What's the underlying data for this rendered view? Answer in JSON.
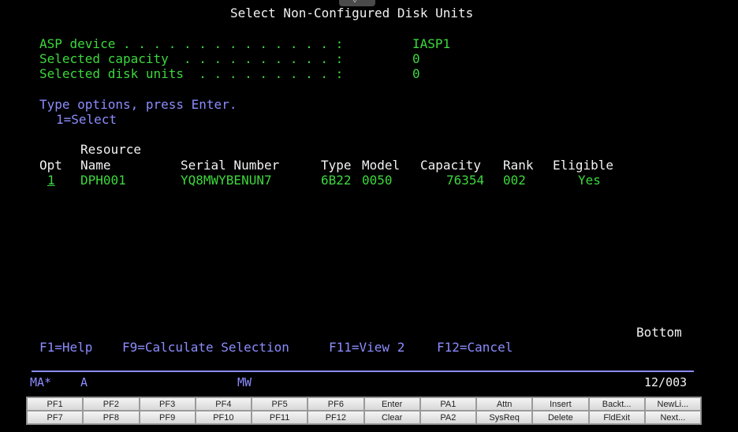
{
  "title": "Select Non-Configured Disk Units",
  "info": [
    {
      "label": "ASP device . . . . . . . . . . . . . . :",
      "value": "IASP1"
    },
    {
      "label": "Selected capacity  . . . . . . . . . . :",
      "value": "0"
    },
    {
      "label": "Selected disk units  . . . . . . . . . :",
      "value": "0"
    }
  ],
  "instructions": {
    "line1": "Type options, press Enter.",
    "line2": "1=Select"
  },
  "table": {
    "header_line1": "Resource",
    "columns": [
      "Opt",
      "Name",
      "Serial Number",
      "Type",
      "Model",
      "Capacity",
      "Rank",
      "Eligible"
    ],
    "rows": [
      {
        "opt": "1",
        "name": "DPH001",
        "serial": "YQ8MWYBENUN7",
        "type": "6B22",
        "model": "0050",
        "capacity": "76354",
        "rank": "002",
        "eligible": "Yes"
      }
    ]
  },
  "bottom_label": "Bottom",
  "function_keys": [
    "F1=Help",
    "F9=Calculate Selection",
    "F11=View 2",
    "F12=Cancel"
  ],
  "status_bar": {
    "left": "MA*",
    "mode": "A",
    "session": "MW",
    "cursor_pos": "12/003"
  },
  "keypad": [
    [
      "PF1",
      "PF2",
      "PF3",
      "PF4",
      "PF5",
      "PF6",
      "Enter",
      "PA1",
      "Attn",
      "Insert",
      "Backt...",
      "NewLi..."
    ],
    [
      "PF7",
      "PF8",
      "PF9",
      "PF10",
      "PF11",
      "PF12",
      "Clear",
      "PA2",
      "SysReq",
      "Delete",
      "FldExit",
      "Next..."
    ]
  ],
  "colors": {
    "background": "#000000",
    "label": "#3cd83c",
    "heading": "#f2f2f2",
    "instruction": "#8c8cff"
  },
  "icons": {
    "drop_handle": "chevron-down-icon"
  }
}
